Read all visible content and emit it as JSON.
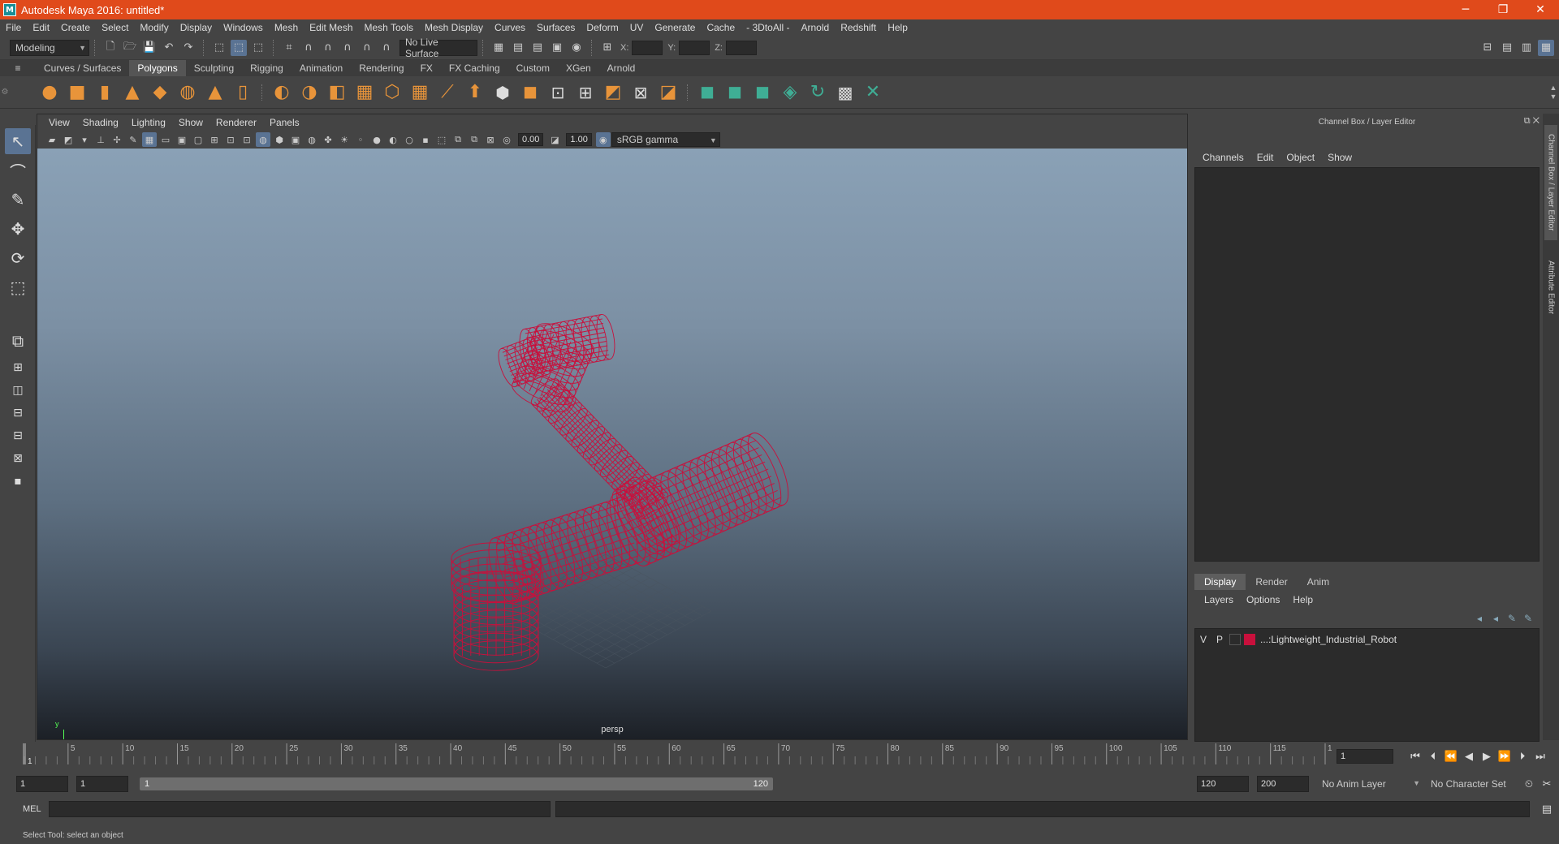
{
  "title": "Autodesk Maya 2016: untitled*",
  "icons": {
    "app": "maya-icon",
    "minimize": "minimize-icon",
    "maximize": "restore-icon",
    "close": "close-icon"
  },
  "menus": [
    "File",
    "Edit",
    "Create",
    "Select",
    "Modify",
    "Display",
    "Windows",
    "Mesh",
    "Edit Mesh",
    "Mesh Tools",
    "Mesh Display",
    "Curves",
    "Surfaces",
    "Deform",
    "UV",
    "Generate",
    "Cache",
    "- 3DtoAll -",
    "Arnold",
    "Redshift",
    "Help"
  ],
  "toolbar": {
    "mode": "Modeling",
    "live_surface": "No Live Surface",
    "x_label": "X:",
    "y_label": "Y:",
    "z_label": "Z:"
  },
  "shelf_tabs": [
    "Curves / Surfaces",
    "Polygons",
    "Sculpting",
    "Rigging",
    "Animation",
    "Rendering",
    "FX",
    "FX Caching",
    "Custom",
    "XGen",
    "Arnold"
  ],
  "shelf_active": "Polygons",
  "viewport": {
    "menus": [
      "View",
      "Shading",
      "Lighting",
      "Show",
      "Renderer",
      "Panels"
    ],
    "exposure": "0.00",
    "gamma": "1.00",
    "color_space": "sRGB gamma",
    "camera": "persp",
    "axis_y": "y",
    "axis_x": "x",
    "wire_color": "#c8103c"
  },
  "channel_box": {
    "header": "Channel Box / Layer Editor",
    "menus": [
      "Channels",
      "Edit",
      "Object",
      "Show"
    ]
  },
  "layer_editor": {
    "tabs": [
      "Display",
      "Render",
      "Anim"
    ],
    "active_tab": "Display",
    "menus": [
      "Layers",
      "Options",
      "Help"
    ],
    "layers": [
      {
        "v": "V",
        "p": "P",
        "color": "#c8103c",
        "name": "...:Lightweight_Industrial_Robot"
      }
    ]
  },
  "side_tabs": [
    "Channel Box / Layer Editor",
    "Attribute Editor"
  ],
  "timeline": {
    "start": 1,
    "end": 120,
    "labels": [
      "5",
      "10",
      "15",
      "20",
      "25",
      "30",
      "35",
      "40",
      "45",
      "50",
      "55",
      "60",
      "65",
      "70",
      "75",
      "80",
      "85",
      "90",
      "95",
      "100",
      "105",
      "110",
      "115",
      "120"
    ],
    "current_frame": "1"
  },
  "range": {
    "start": "1",
    "playback_start": "1",
    "slider_start": "1",
    "slider_end": "120",
    "playback_end": "120",
    "end": "200",
    "anim_layer": "No Anim Layer",
    "character_set": "No Character Set"
  },
  "mel_label": "MEL",
  "status": "Select Tool: select an object"
}
